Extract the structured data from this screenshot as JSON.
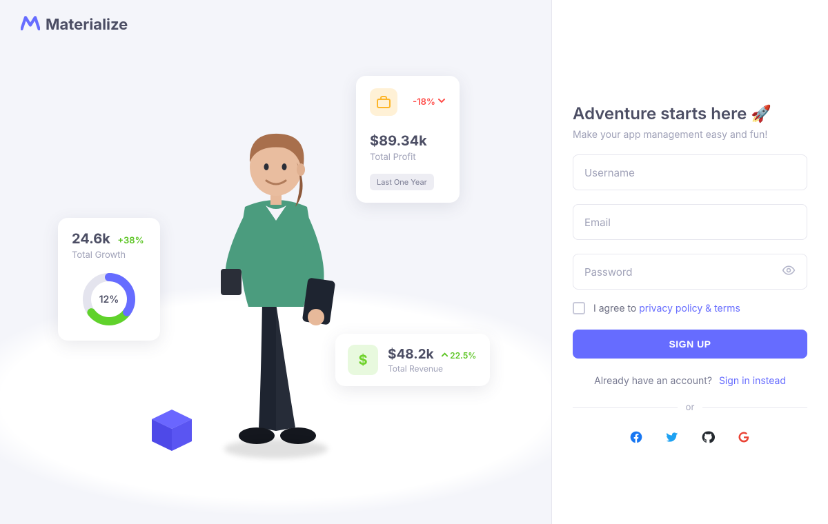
{
  "brand": {
    "name": "Materialize"
  },
  "illustration": {
    "profit_card": {
      "change_pct": "-18%",
      "change_direction": "down",
      "value": "$89.34k",
      "label": "Total Profit",
      "period_pill": "Last One Year"
    },
    "growth_card": {
      "value": "24.6k",
      "change_pct": "+38%",
      "label": "Total Growth",
      "ring_center": "12%",
      "ring_segments": {
        "blue_pct": 35,
        "green_pct": 30,
        "grey_pct": 35
      }
    },
    "revenue_card": {
      "value": "$48.2k",
      "change_pct": "22.5%",
      "change_direction": "up",
      "label": "Total Revenue"
    }
  },
  "form": {
    "title": "Adventure starts here 🚀",
    "subtitle": "Make your app management easy and fun!",
    "username_placeholder": "Username",
    "email_placeholder": "Email",
    "password_placeholder": "Password",
    "agree_prefix": "I agree to ",
    "agree_link": "privacy policy & terms",
    "submit_label": "SIGN UP",
    "have_account_text": "Already have an account?",
    "signin_link": "Sign in instead",
    "divider_label": "or"
  },
  "social": [
    "facebook",
    "twitter",
    "github",
    "google"
  ],
  "colors": {
    "primary": "#666CFF",
    "success": "#72E128",
    "error": "#FF4D49",
    "warning": "#FDB528"
  }
}
